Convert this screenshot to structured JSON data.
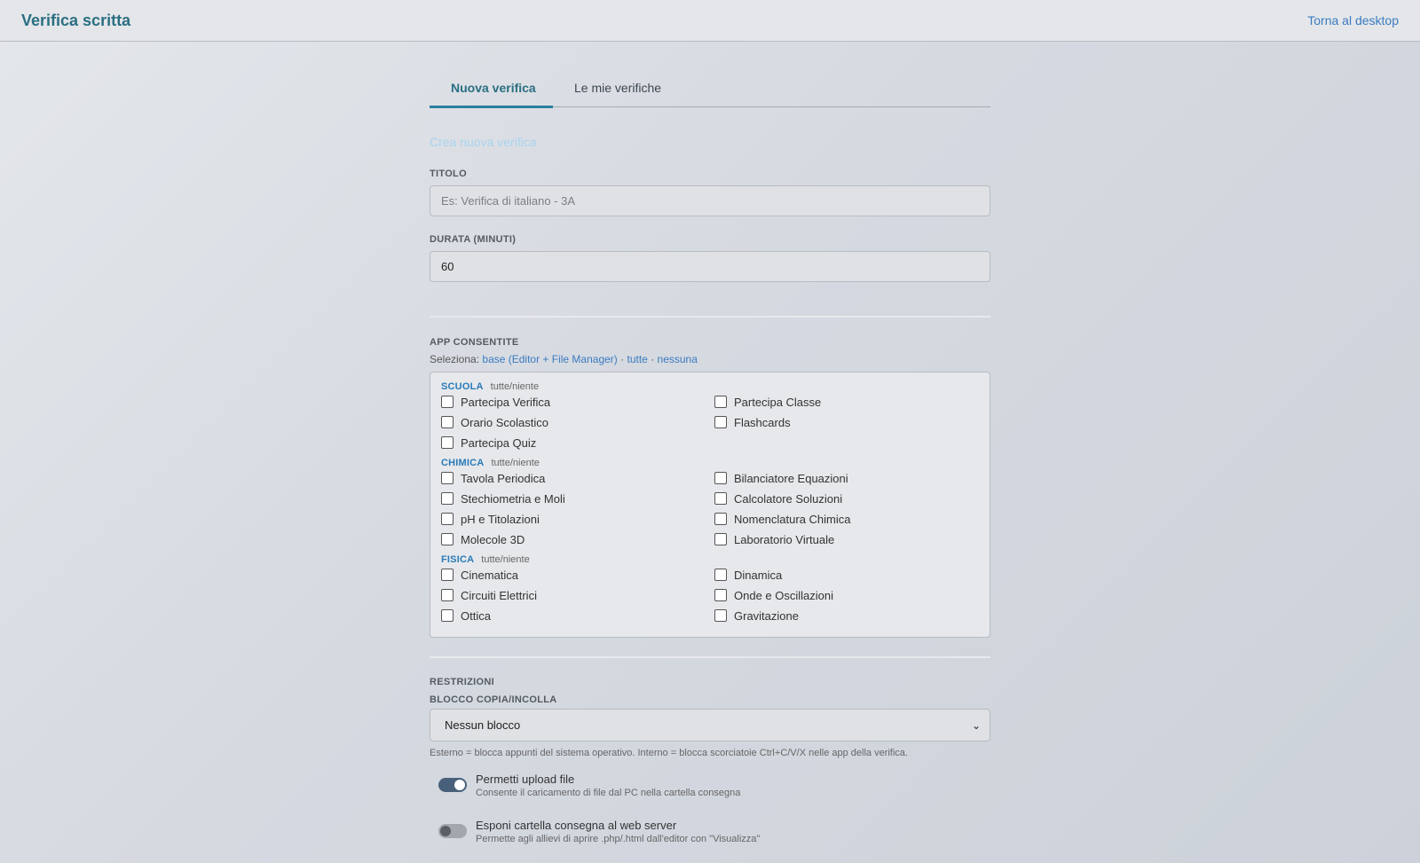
{
  "header": {
    "title": "Verifica scritta",
    "back_link": "Torna al desktop"
  },
  "tabs": [
    {
      "label": "Nuova verifica",
      "active": true
    },
    {
      "label": "Le mie verifiche",
      "active": false
    }
  ],
  "form": {
    "section_title": "Crea nuova verifica",
    "title_label": "TITOLO",
    "title_placeholder": "Es: Verifica di italiano - 3A",
    "title_value": "",
    "duration_label": "DURATA (MINUTI)",
    "duration_value": "60"
  },
  "apps": {
    "heading": "APP CONSENTITE",
    "select_prefix": "Seleziona:",
    "select_base": "base (Editor + File Manager)",
    "sep1": "·",
    "select_all": "tutte",
    "sep2": "·",
    "select_none": "nessuna",
    "toggle_label": "tutte/niente",
    "groups": [
      {
        "name": "SCUOLA",
        "items": [
          "Partecipa Verifica",
          "Partecipa Classe",
          "Orario Scolastico",
          "Flashcards",
          "Partecipa Quiz"
        ]
      },
      {
        "name": "CHIMICA",
        "items": [
          "Tavola Periodica",
          "Bilanciatore Equazioni",
          "Stechiometria e Moli",
          "Calcolatore Soluzioni",
          "pH e Titolazioni",
          "Nomenclatura Chimica",
          "Molecole 3D",
          "Laboratorio Virtuale"
        ]
      },
      {
        "name": "FISICA",
        "items": [
          "Cinematica",
          "Dinamica",
          "Circuiti Elettrici",
          "Onde e Oscillazioni",
          "Ottica",
          "Gravitazione"
        ]
      }
    ]
  },
  "restrictions": {
    "heading": "RESTRIZIONI",
    "copy_label": "BLOCCO COPIA/INCOLLA",
    "copy_value": "Nessun blocco",
    "copy_help": "Esterno = blocca appunti del sistema operativo. Interno = blocca scorciatoie Ctrl+C/V/X nelle app della verifica.",
    "upload_title": "Permetti upload file",
    "upload_desc": "Consente il caricamento di file dal PC nella cartella consegna",
    "upload_on": true,
    "web_title": "Esponi cartella consegna al web server",
    "web_desc": "Permette agli allievi di aprire .php/.html dall'editor con \"Visualizza\"",
    "web_on": false
  }
}
